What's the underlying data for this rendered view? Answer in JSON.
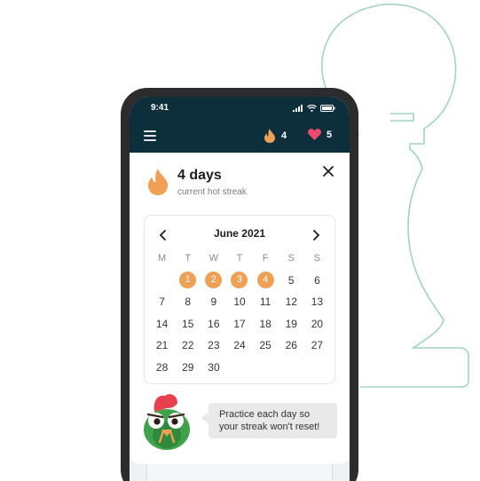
{
  "status_bar": {
    "time": "9:41"
  },
  "app_bar": {
    "menu_icon": "hamburger-menu-icon",
    "streak_count": "4",
    "lives_count": "5",
    "colors": {
      "bar": "#0d2f3c",
      "flame": "#f0a054",
      "heart": "#ef4a6b"
    }
  },
  "streak": {
    "title": "4 days",
    "subtitle": "current hot streak"
  },
  "calendar": {
    "month": "June 2021",
    "weekdays": [
      "M",
      "T",
      "W",
      "T",
      "F",
      "S",
      "S"
    ],
    "weeks": [
      [
        "1",
        "2",
        "3",
        "4",
        "5",
        "6"
      ],
      [
        "7",
        "8",
        "9",
        "10",
        "11",
        "12",
        "13"
      ],
      [
        "14",
        "15",
        "16",
        "17",
        "18",
        "19",
        "20"
      ],
      [
        "21",
        "22",
        "23",
        "24",
        "25",
        "26",
        "27"
      ],
      [
        "28",
        "29",
        "30"
      ]
    ],
    "streak_days": [
      "1",
      "2",
      "3",
      "4"
    ],
    "highlight_color": "#f0a054"
  },
  "mascot": {
    "message_line1": "Practice each day so",
    "message_line2": "your streak won't reset!"
  }
}
